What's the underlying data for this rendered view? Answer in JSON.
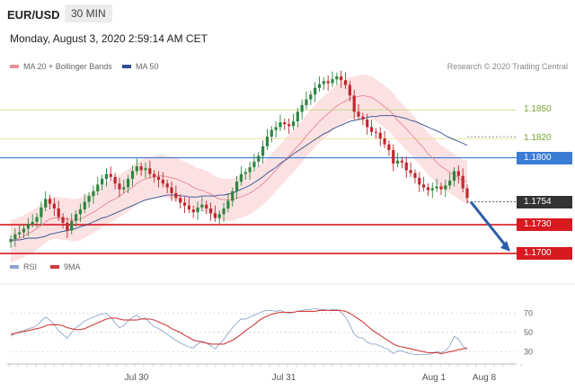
{
  "header": {
    "symbol": "EUR/USD",
    "timeframe": "30 MIN"
  },
  "datetime": "Monday, August 3, 2020 2:59:14 AM CET",
  "legend": [
    {
      "label": "MA 20 + Bollinger Bands",
      "color": "#e8909a"
    },
    {
      "label": "MA 50",
      "color": "#2f4f8f"
    }
  ],
  "credit": "Research © 2020 Trading Central",
  "chart_data": [
    {
      "type": "candlestick",
      "title": "",
      "x_ticks": [
        "Jul 30",
        "Jul 31",
        "Aug 1",
        "Aug 8"
      ],
      "ylim": [
        1.1685,
        1.1885
      ],
      "levels": [
        {
          "label": "1.1850",
          "value": 1.185,
          "color": "#b7d97a",
          "style": "text"
        },
        {
          "label": "1.1820",
          "value": 1.182,
          "color": "#e8d98a",
          "style": "text"
        },
        {
          "label": "1.1800",
          "value": 1.18,
          "color": "#3a7bd5",
          "style": "fill"
        },
        {
          "label": "1.1754",
          "value": 1.1754,
          "color": "#333333",
          "style": "fill"
        },
        {
          "label": "1.1730",
          "value": 1.173,
          "color": "#d71920",
          "style": "fill"
        },
        {
          "label": "1.1700",
          "value": 1.17,
          "color": "#d71920",
          "style": "fill"
        }
      ],
      "close": [
        1.1715,
        1.172,
        1.1722,
        1.1726,
        1.1731,
        1.1733,
        1.1738,
        1.1748,
        1.1757,
        1.1752,
        1.1747,
        1.1738,
        1.1732,
        1.1724,
        1.1734,
        1.1741,
        1.1746,
        1.1754,
        1.176,
        1.1765,
        1.1772,
        1.1778,
        1.1783,
        1.178,
        1.1773,
        1.1767,
        1.1769,
        1.1778,
        1.1786,
        1.1791,
        1.1787,
        1.1789,
        1.1783,
        1.178,
        1.1777,
        1.1773,
        1.1769,
        1.1763,
        1.1758,
        1.1753,
        1.175,
        1.1746,
        1.1743,
        1.1748,
        1.1751,
        1.1747,
        1.1742,
        1.1737,
        1.1741,
        1.1747,
        1.1755,
        1.1765,
        1.1775,
        1.1783,
        1.1785,
        1.179,
        1.1796,
        1.1802,
        1.1812,
        1.1822,
        1.1829,
        1.1832,
        1.1837,
        1.1835,
        1.1833,
        1.1838,
        1.1848,
        1.1855,
        1.1861,
        1.1866,
        1.1873,
        1.1877,
        1.188,
        1.1878,
        1.1882,
        1.1885,
        1.1881,
        1.1876,
        1.1865,
        1.1848,
        1.1843,
        1.184,
        1.1832,
        1.1827,
        1.1826,
        1.182,
        1.1814,
        1.1808,
        1.1794,
        1.1797,
        1.1795,
        1.1787,
        1.1784,
        1.1779,
        1.1772,
        1.1769,
        1.1766,
        1.1768,
        1.177,
        1.1767,
        1.1771,
        1.1776,
        1.1786,
        1.1781,
        1.1768,
        1.1758
      ],
      "ma20": [
        1.1713,
        1.1714,
        1.1716,
        1.1718,
        1.1721,
        1.1723,
        1.1726,
        1.1729,
        1.1733,
        1.1736,
        1.1737,
        1.1737,
        1.1736,
        1.1736,
        1.1735,
        1.1735,
        1.1736,
        1.1738,
        1.1741,
        1.1743,
        1.1746,
        1.1749,
        1.1752,
        1.1755,
        1.1757,
        1.176,
        1.1763,
        1.1766,
        1.1769,
        1.1773,
        1.1776,
        1.1778,
        1.1779,
        1.178,
        1.1781,
        1.1781,
        1.178,
        1.1779,
        1.1778,
        1.1776,
        1.1774,
        1.1772,
        1.1769,
        1.1767,
        1.1766,
        1.1764,
        1.1762,
        1.1759,
        1.1757,
        1.1756,
        1.1756,
        1.1756,
        1.1758,
        1.1759,
        1.1761,
        1.1763,
        1.1766,
        1.1769,
        1.1773,
        1.1777,
        1.1782,
        1.1787,
        1.1792,
        1.1797,
        1.1802,
        1.1807,
        1.1812,
        1.1817,
        1.1823,
        1.1828,
        1.1833,
        1.1838,
        1.1842,
        1.1846,
        1.185,
        1.1854,
        1.1857,
        1.1859,
        1.1862,
        1.1863,
        1.1864,
        1.1865,
        1.1864,
        1.1863,
        1.186,
        1.1857,
        1.1853,
        1.185,
        1.1845,
        1.1839,
        1.1835,
        1.183,
        1.1825,
        1.182,
        1.1815,
        1.181,
        1.1804,
        1.18,
        1.1795,
        1.1791,
        1.1788,
        1.1785,
        1.1782,
        1.1779,
        1.1776,
        1.1775
      ],
      "ma50": [
        1.1714,
        1.1714,
        1.1714,
        1.1715,
        1.1716,
        1.1716,
        1.1716,
        1.1717,
        1.1718,
        1.172,
        1.1721,
        1.1722,
        1.1723,
        1.1724,
        1.1725,
        1.1726,
        1.1728,
        1.1729,
        1.1731,
        1.1733,
        1.1735,
        1.1737,
        1.1738,
        1.174,
        1.1742,
        1.1744,
        1.1746,
        1.1748,
        1.175,
        1.1752,
        1.1754,
        1.1756,
        1.1757,
        1.1758,
        1.1759,
        1.176,
        1.1761,
        1.1761,
        1.1761,
        1.176,
        1.176,
        1.1759,
        1.1759,
        1.1759,
        1.176,
        1.176,
        1.176,
        1.176,
        1.1761,
        1.1761,
        1.1762,
        1.1763,
        1.1765,
        1.1767,
        1.1769,
        1.1771,
        1.1774,
        1.1777,
        1.178,
        1.1784,
        1.1787,
        1.179,
        1.1794,
        1.1797,
        1.18,
        1.1804,
        1.1807,
        1.181,
        1.1813,
        1.1816,
        1.1819,
        1.1822,
        1.1825,
        1.1827,
        1.183,
        1.1832,
        1.1834,
        1.1836,
        1.1838,
        1.1839,
        1.184,
        1.1841,
        1.1842,
        1.1843,
        1.1843,
        1.1844,
        1.1844,
        1.1844,
        1.1844,
        1.1843,
        1.1842,
        1.1841,
        1.1839,
        1.1838,
        1.1836,
        1.1834,
        1.1832,
        1.183,
        1.1828,
        1.1826,
        1.1823,
        1.1821,
        1.1819,
        1.1817,
        1.1815,
        1.1813
      ]
    },
    {
      "type": "line",
      "title": "",
      "ylim": [
        22,
        78
      ],
      "y_ticks": [
        70,
        50,
        30
      ],
      "series": [
        {
          "name": "RSI",
          "color": "#8fa6c9",
          "values": [
            46,
            49,
            51,
            52,
            54,
            55,
            57,
            62,
            66,
            63,
            58,
            52,
            48,
            44,
            50,
            55,
            58,
            62,
            64,
            66,
            68,
            69,
            70,
            66,
            60,
            55,
            57,
            62,
            66,
            68,
            64,
            65,
            60,
            56,
            54,
            51,
            48,
            45,
            42,
            39,
            37,
            35,
            34,
            38,
            41,
            39,
            36,
            33,
            38,
            43,
            49,
            55,
            60,
            64,
            64,
            66,
            68,
            70,
            72,
            73,
            73,
            72,
            73,
            71,
            70,
            71,
            72,
            73,
            74,
            74,
            75,
            74,
            74,
            73,
            74,
            74,
            71,
            66,
            58,
            48,
            45,
            44,
            40,
            38,
            38,
            36,
            34,
            32,
            28,
            31,
            31,
            29,
            28,
            27,
            27,
            27,
            27,
            28,
            30,
            29,
            31,
            36,
            46,
            43,
            36,
            32
          ]
        },
        {
          "name": "9MA",
          "color": "#d13a3a",
          "values": [
            48,
            49,
            50,
            51,
            52,
            53,
            54,
            55,
            57,
            58,
            58,
            58,
            57,
            55,
            54,
            53,
            53,
            54,
            56,
            58,
            60,
            62,
            64,
            65,
            65,
            64,
            63,
            63,
            63,
            63,
            64,
            64,
            64,
            63,
            61,
            59,
            57,
            54,
            52,
            50,
            47,
            45,
            42,
            41,
            40,
            39,
            38,
            38,
            38,
            38,
            40,
            42,
            45,
            48,
            52,
            55,
            58,
            62,
            65,
            67,
            69,
            70,
            71,
            71,
            71,
            71,
            72,
            72,
            72,
            72,
            72,
            73,
            73,
            73,
            73,
            73,
            73,
            72,
            70,
            67,
            64,
            61,
            57,
            53,
            50,
            47,
            44,
            41,
            38,
            36,
            35,
            34,
            33,
            32,
            31,
            30,
            29,
            29,
            29,
            28,
            29,
            30,
            31,
            32,
            33,
            34
          ]
        }
      ]
    }
  ]
}
